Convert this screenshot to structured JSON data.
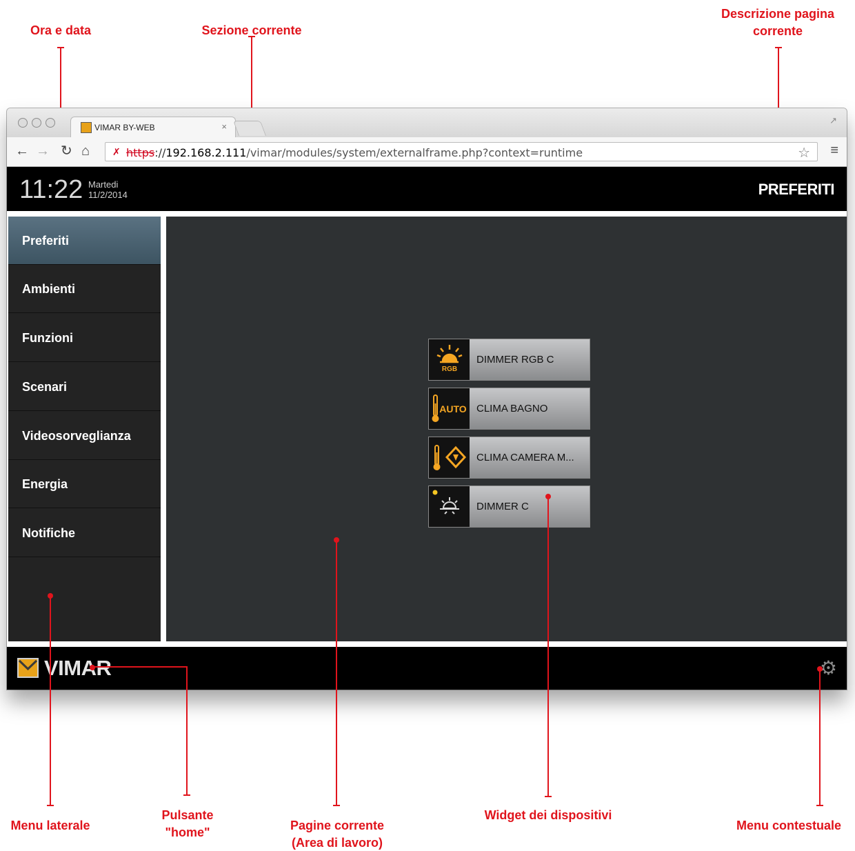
{
  "annotations": {
    "ora_data": "Ora e data",
    "sezione_corrente": "Sezione corrente",
    "descrizione_line1": "Descrizione pagina",
    "descrizione_line2": "corrente",
    "menu_laterale": "Menu laterale",
    "pulsante_line1": "Pulsante",
    "pulsante_line2": "\"home\"",
    "pagine_line1": "Pagine corrente",
    "pagine_line2": "(Area di lavoro)",
    "widget_dispositivi": "Widget dei dispositivi",
    "menu_contestuale": "Menu contestuale"
  },
  "browser": {
    "tab_title": "VIMAR BY-WEB",
    "tab_close": "×",
    "url_scheme": "https",
    "url_sep": "://",
    "url_host": "192.168.2.111",
    "url_path": "/vimar/modules/system/externalframe.php?context=runtime"
  },
  "header": {
    "time": "11:22",
    "weekday": "Martedi",
    "date": "11/2/2014",
    "page_title": "PREFERITI"
  },
  "sidebar": {
    "items": [
      {
        "label": "Preferiti"
      },
      {
        "label": "Ambienti"
      },
      {
        "label": "Funzioni"
      },
      {
        "label": "Scenari"
      },
      {
        "label": "Videosorveglianza"
      },
      {
        "label": "Energia"
      },
      {
        "label": "Notifiche"
      }
    ]
  },
  "widgets": [
    {
      "label": "DIMMER RGB C",
      "icon": "rgb-light-icon",
      "icon_text": "RGB"
    },
    {
      "label": "CLIMA BAGNO",
      "icon": "thermometer-auto-icon",
      "icon_text": "AUTO"
    },
    {
      "label": "CLIMA CAMERA M...",
      "icon": "thermometer-manual-icon"
    },
    {
      "label": "DIMMER C",
      "icon": "light-bulb-icon"
    }
  ],
  "footer": {
    "logo_text": "VIMAR"
  },
  "colors": {
    "callout": "#e0141c",
    "icon_active": "#f5a623",
    "active_menu": "#4d6473"
  }
}
